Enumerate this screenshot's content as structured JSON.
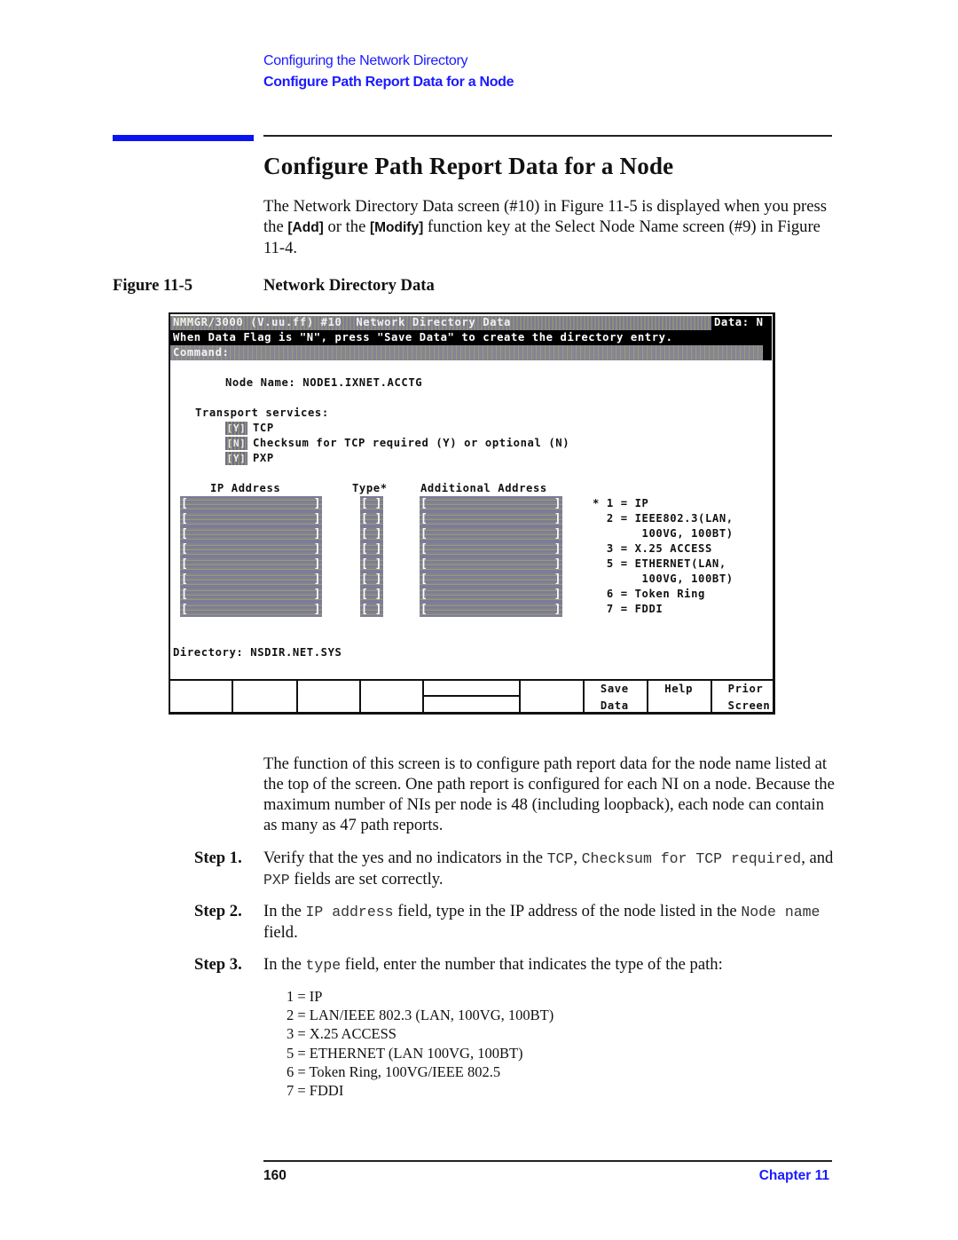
{
  "running_head": {
    "chapter_title": "Configuring the Network Directory",
    "section_title": "Configure Path Report Data for a Node"
  },
  "heading": "Configure Path Report Data for a Node",
  "intro": {
    "part1": "The Network Directory Data screen (#10) in Figure 11-5 is displayed when you press the ",
    "key_add": "[Add]",
    "part2": " or the ",
    "key_modify": "[Modify]",
    "part3": " function key at the Select Node Name screen (#9) in Figure 11-4."
  },
  "figure": {
    "label": "Figure 11-5",
    "title": "Network Directory Data"
  },
  "terminal": {
    "title": "NMMGR/3000 (V.uu.ff) #10  Network Directory Data",
    "data_flag": "Data: N",
    "message": "When Data Flag is \"N\", press \"Save Data\" to create the directory entry.",
    "command_label": "Command:",
    "node_name": "Node Name: NODE1.IXNET.ACCTG",
    "transport_label": "Transport services:",
    "transport_services": [
      {
        "value": "Y",
        "label": "TCP"
      },
      {
        "value": "N",
        "label": "Checksum for TCP required (Y) or optional (N)"
      },
      {
        "value": "Y",
        "label": "PXP"
      }
    ],
    "columns": {
      "ip": "IP Address",
      "type": "Type*",
      "additional": "Additional Address"
    },
    "rows": [
      {
        "ip": "",
        "type": "",
        "additional": ""
      },
      {
        "ip": "",
        "type": "",
        "additional": ""
      },
      {
        "ip": "",
        "type": "",
        "additional": ""
      },
      {
        "ip": "",
        "type": "",
        "additional": ""
      },
      {
        "ip": "",
        "type": "",
        "additional": ""
      },
      {
        "ip": "",
        "type": "",
        "additional": ""
      },
      {
        "ip": "",
        "type": "",
        "additional": ""
      },
      {
        "ip": "",
        "type": "",
        "additional": ""
      }
    ],
    "type_legend": [
      "* 1 = IP",
      "  2 = IEEE802.3(LAN,",
      "       100VG, 100BT)",
      "  3 = X.25 ACCESS",
      "  5 = ETHERNET(LAN,",
      "       100VG, 100BT)",
      "  6 = Token Ring",
      "  7 = FDDI"
    ],
    "directory": "Directory: NSDIR.NET.SYS",
    "function_keys": [
      {
        "line1": "",
        "line2": ""
      },
      {
        "line1": "",
        "line2": ""
      },
      {
        "line1": "",
        "line2": ""
      },
      {
        "line1": "",
        "line2": ""
      },
      {
        "line1": "",
        "line2": ""
      },
      {
        "line1": "",
        "line2": ""
      },
      {
        "line1": "Save",
        "line2": "Data"
      },
      {
        "line1": "Help",
        "line2": ""
      },
      {
        "line1": "Prior",
        "line2": "Screen"
      }
    ]
  },
  "description": "The function of this screen is to configure path report data for the node name listed at the top of the screen. One path report is configured for each NI on a node. Because the maximum number of NIs per node is 48 (including loopback), each node can contain as many as 47 path reports.",
  "steps": [
    {
      "label": "Step 1.",
      "t1": "Verify that the yes and no indicators in the ",
      "c1": "TCP",
      "t2": ", ",
      "c2": "Checksum for TCP required",
      "t3": ", and ",
      "c3": "PXP",
      "t4": " fields are set correctly."
    },
    {
      "label": "Step 2.",
      "t1": "In the ",
      "c1": "IP address",
      "t2": " field, type in the IP address of the node listed in the ",
      "c2": "Node name",
      "t3": " field."
    },
    {
      "label": "Step 3.",
      "t1": "In the ",
      "c1": "type",
      "t2": " field, enter the number that indicates the type of the path:"
    }
  ],
  "path_types": [
    "1 = IP",
    "2 = LAN/IEEE 802.3 (LAN, 100VG, 100BT)",
    "3 = X.25 ACCESS",
    "5 = ETHERNET (LAN 100VG, 100BT)",
    "6 = Token Ring, 100VG/IEEE 802.5",
    "7 = FDDI"
  ],
  "footer": {
    "page_number": "160",
    "chapter": "Chapter 11"
  }
}
